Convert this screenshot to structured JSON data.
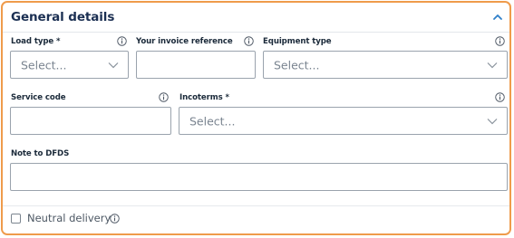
{
  "section": {
    "title": "General details",
    "collapse_icon": "chevron-up-icon"
  },
  "fields": {
    "load_type": {
      "label": "Load type *",
      "placeholder": "Select..."
    },
    "invoice_reference": {
      "label": "Your invoice reference",
      "value": ""
    },
    "equipment_type": {
      "label": "Equipment type",
      "placeholder": "Select..."
    },
    "service_code": {
      "label": "Service code",
      "value": ""
    },
    "incoterms": {
      "label": "Incoterms *",
      "placeholder": "Select..."
    },
    "note_to_dfds": {
      "label": "Note to DFDS",
      "value": ""
    }
  },
  "neutral_delivery": {
    "label": "Neutral delivery",
    "checked": false
  },
  "colors": {
    "panel_border": "#ef9b4b",
    "title": "#1b2f52",
    "field_border": "#9aa3ad"
  }
}
